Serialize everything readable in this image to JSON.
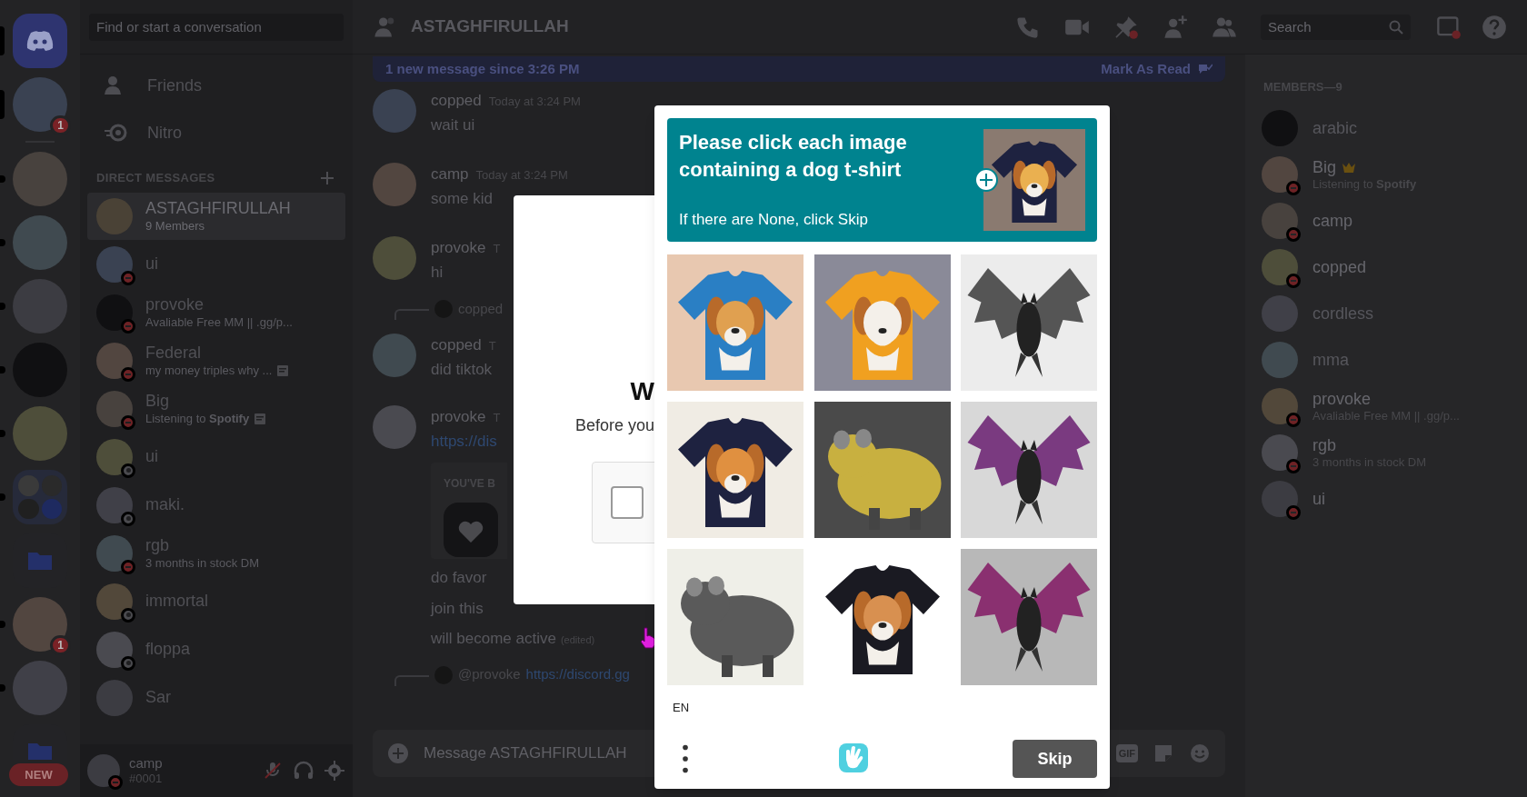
{
  "servers": [
    {
      "kind": "home",
      "selected": true
    },
    {
      "kind": "avatar",
      "selected": true,
      "badge": "1"
    },
    {
      "kind": "avatar",
      "selected": false,
      "unread": true
    },
    {
      "kind": "avatar",
      "selected": false,
      "unread": true
    },
    {
      "kind": "avatar",
      "selected": false,
      "unread": true
    },
    {
      "kind": "avatar",
      "selected": false,
      "unread": true
    },
    {
      "kind": "avatar",
      "selected": false,
      "unread": true
    },
    {
      "kind": "group",
      "selected": false,
      "unread": true
    },
    {
      "kind": "folder",
      "selected": false,
      "unread": false
    },
    {
      "kind": "avatar",
      "selected": false,
      "unread": true,
      "badge": "1"
    },
    {
      "kind": "avatar",
      "selected": false,
      "unread": true
    },
    {
      "kind": "folder",
      "selected": false,
      "unread": false
    }
  ],
  "new_pill": "NEW",
  "dm_sidebar": {
    "search_placeholder": "Find or start a conversation",
    "nav": [
      {
        "kind": "friends",
        "label": "Friends"
      },
      {
        "kind": "nitro",
        "label": "Nitro"
      }
    ],
    "heading": "DIRECT MESSAGES",
    "conversations": [
      {
        "name": "ASTAGHFIRULLAH",
        "subtitle": "9 Members",
        "dnd": false,
        "offline": false,
        "selected": true,
        "activity": false
      },
      {
        "name": "ui",
        "dnd": true,
        "selected": false
      },
      {
        "name": "provoke",
        "subtitle": "Avaliable Free MM || .gg/p...",
        "dnd": true,
        "selected": false,
        "activity": false
      },
      {
        "name": "Federal",
        "subtitle": "my money triples why ...",
        "dnd": true,
        "selected": false,
        "activity": true
      },
      {
        "name": "Big",
        "subtitle": "Listening to **Spotify**",
        "dnd": true,
        "selected": false,
        "activity": true
      },
      {
        "name": "ui",
        "dnd": false,
        "offline": true,
        "selected": false
      },
      {
        "name": "maki.",
        "dnd": false,
        "offline": true,
        "selected": false
      },
      {
        "name": "rgb",
        "subtitle": "3 months in stock DM",
        "dnd": true,
        "selected": false,
        "activity": false
      },
      {
        "name": "immortal",
        "dnd": false,
        "offline": true,
        "selected": false
      },
      {
        "name": "floppa",
        "dnd": false,
        "offline": true,
        "selected": false
      },
      {
        "name": "Sar",
        "dnd": false,
        "offline": false,
        "selected": false
      }
    ],
    "user": {
      "name": "camp",
      "tag": "#0001",
      "dnd": true
    }
  },
  "chat": {
    "title": "ASTAGHFIRULLAH",
    "search_placeholder": "Search",
    "banner": "1 new message since 3:26 PM",
    "mark_read": "Mark As Read",
    "messages": [
      {
        "kind": "message",
        "author": "copped",
        "time": "Today at 3:24 PM",
        "text": "wait ui"
      },
      {
        "kind": "message",
        "author": "camp",
        "time": "Today at 3:24 PM",
        "text": "some kid"
      },
      {
        "kind": "message",
        "author": "provoke",
        "time": "T",
        "text": "hi"
      },
      {
        "kind": "reply",
        "author": "copped"
      },
      {
        "kind": "message",
        "author": "copped",
        "time": "T",
        "text": "did tiktok"
      },
      {
        "kind": "message",
        "author": "provoke",
        "time": "T",
        "link": "https://dis"
      },
      {
        "kind": "invite",
        "heading": "YOU'VE B"
      },
      {
        "kind": "line",
        "text": "do favor"
      },
      {
        "kind": "line",
        "text": "join this"
      },
      {
        "kind": "line",
        "text": "will become active",
        "edited": "(edited)"
      },
      {
        "kind": "reply",
        "author": "@provoke",
        "link": "https://discord.gg"
      }
    ],
    "composer_placeholder": "Message ASTAGHFIRULLAH",
    "gif": "GIF"
  },
  "modal": {
    "title": "W",
    "text": "Before you",
    "checked": false
  },
  "members": {
    "heading": "MEMBERS—9",
    "list": [
      {
        "name": "arabic",
        "offline": true,
        "crown": false
      },
      {
        "name": "Big",
        "subtitle": "Listening to **Spotify**",
        "offline": false,
        "crown": true
      },
      {
        "name": "camp",
        "offline": false,
        "crown": false
      },
      {
        "name": "copped",
        "offline": false,
        "crown": false
      },
      {
        "name": "cordless",
        "offline": true,
        "crown": false
      },
      {
        "name": "mma",
        "offline": true,
        "crown": false
      },
      {
        "name": "provoke",
        "subtitle": "Avaliable Free MM || .gg/p...",
        "offline": false,
        "crown": false
      },
      {
        "name": "rgb",
        "subtitle": "3 months in stock DM",
        "offline": false,
        "crown": false
      },
      {
        "name": "ui",
        "offline": false,
        "crown": false
      }
    ]
  },
  "captcha": {
    "prompt": "Please click each image containing a dog t-shirt",
    "hint": "If there are None, click Skip",
    "language": "EN",
    "skip": "Skip"
  }
}
